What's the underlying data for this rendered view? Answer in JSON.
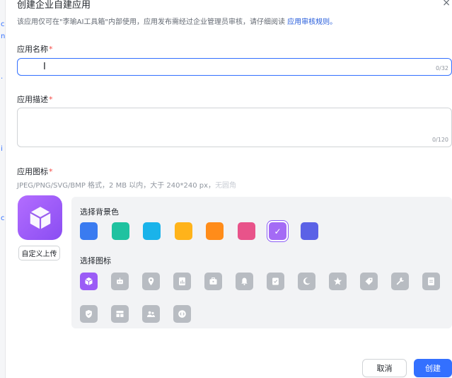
{
  "dialog": {
    "title": "创建企业自建应用",
    "notice_text": "该应用仅可在\"李瑜AI工具箱\"内部使用，应用发布需经过企业管理员审核，请仔细阅读 ",
    "notice_link": "应用审核规则",
    "notice_tail": "。"
  },
  "fields": {
    "name_label": "应用名称",
    "name_value": "",
    "name_counter": "0/32",
    "desc_label": "应用描述",
    "desc_value": "",
    "desc_counter": "0/120",
    "required_mark": "*"
  },
  "icon_section": {
    "label": "应用图标",
    "hint": "JPEG/PNG/SVG/BMP 格式，2 MB 以内，大于 240*240 px，",
    "hint_faded": "无圆角",
    "upload_label": "自定义上传",
    "bg_label": "选择背景色",
    "icon_label": "选择图标",
    "selected_color_index": 6,
    "selected_icon_index": 0,
    "colors": [
      "#3a7bf0",
      "#1fc2a0",
      "#1ab3ea",
      "#ffb31a",
      "#ff8c1a",
      "#e8538a",
      "#a46bf5",
      "#5b62e6"
    ],
    "icons": [
      "box-icon",
      "robot-icon",
      "map-pin-icon",
      "document-chart-icon",
      "briefcase-icon",
      "bell-icon",
      "checklist-icon",
      "moon-icon",
      "star-icon",
      "tag-icon",
      "wrench-icon",
      "notes-icon",
      "shield-check-icon",
      "layout-icon",
      "people-icon",
      "code-icon"
    ]
  },
  "footer": {
    "cancel_label": "取消",
    "create_label": "创建"
  },
  "left_strip_chars": [
    "c",
    "n",
    "·",
    "i",
    "c"
  ]
}
